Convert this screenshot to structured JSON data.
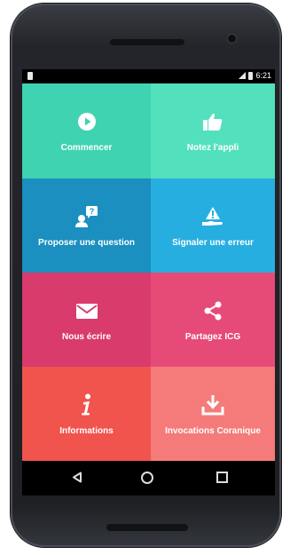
{
  "status_bar": {
    "time": "6:21"
  },
  "tiles": [
    {
      "label": "Commencer",
      "icon": "play-circle-icon",
      "color": "#3fd3b2"
    },
    {
      "label": "Notez l'appli",
      "icon": "thumbs-up-icon",
      "color": "#53e0bd"
    },
    {
      "label": "Proposer une question",
      "icon": "user-question-icon",
      "color": "#1a8fc0"
    },
    {
      "label": "Signaler une erreur",
      "icon": "warning-hand-icon",
      "color": "#27aee0"
    },
    {
      "label": "Nous écrire",
      "icon": "envelope-icon",
      "color": "#d93b6c"
    },
    {
      "label": "Partagez ICG",
      "icon": "share-icon",
      "color": "#e64b78"
    },
    {
      "label": "Informations",
      "icon": "info-icon",
      "color": "#f0544d"
    },
    {
      "label": "Invocations Coranique",
      "icon": "download-icon",
      "color": "#f47b7a"
    }
  ],
  "navigation": {
    "back": "back-icon",
    "home": "home-icon",
    "recent": "recent-apps-icon"
  }
}
